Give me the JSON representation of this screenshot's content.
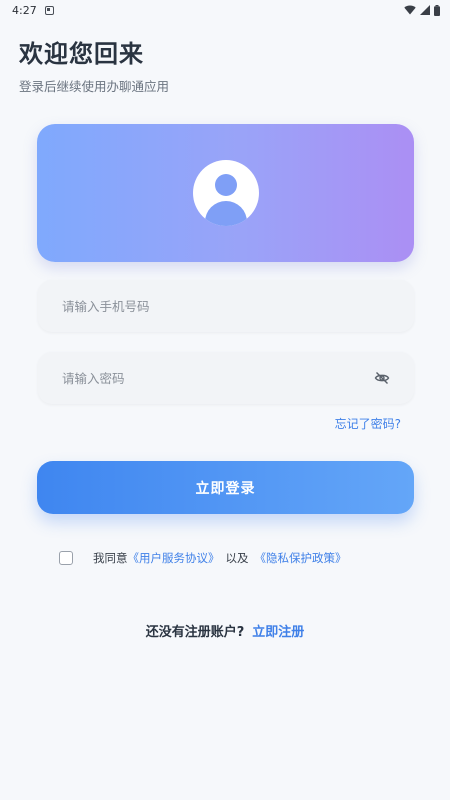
{
  "status_bar": {
    "time": "4:27",
    "icons": [
      "notification-icon",
      "wifi-icon",
      "signal-icon",
      "battery-icon"
    ]
  },
  "header": {
    "title": "欢迎您回来",
    "subtitle": "登录后继续使用办聊通应用"
  },
  "hero": {
    "avatar_icon": "user-avatar-icon",
    "gradient_start": "#7fa9fd",
    "gradient_end": "#ab8ff4"
  },
  "form": {
    "phone": {
      "value": "",
      "placeholder": "请输入手机号码"
    },
    "password": {
      "value": "",
      "placeholder": "请输入密码",
      "toggle_icon": "eye-off-icon"
    },
    "forgot_label": "忘记了密码?",
    "login_label": "立即登录"
  },
  "agreement": {
    "checked": false,
    "prefix": "我同意",
    "terms_label": "《用户服务协议》",
    "connector": "以及",
    "privacy_label": "《隐私保护政策》"
  },
  "register": {
    "prompt": "还没有注册账户?",
    "link_label": "立即注册"
  },
  "colors": {
    "accent": "#3f80e8",
    "background": "#f6f8fb"
  }
}
